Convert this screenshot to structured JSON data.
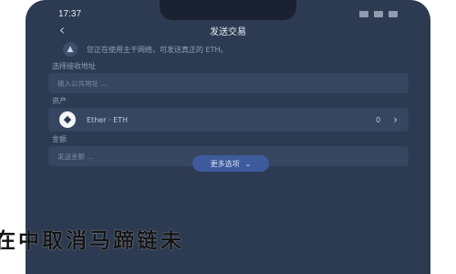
{
  "status_bar": {
    "time": "17:37"
  },
  "header": {
    "back_icon": "chevron-left-icon",
    "title": "发送交易"
  },
  "notice": {
    "icon": "warning-icon",
    "text": "您正在使用主干网络，可发送真正的 ETH。"
  },
  "form": {
    "address": {
      "label": "选择接收地址",
      "placeholder": "输入公共地址 ..."
    },
    "asset": {
      "label": "资产",
      "name": "Ether · ETH",
      "balance": "0"
    },
    "amount": {
      "label": "金额",
      "placeholder": "发送金额 ..."
    }
  },
  "more_button": {
    "label": "更多选项"
  },
  "overlay_text": "在中取消马蹄链未"
}
